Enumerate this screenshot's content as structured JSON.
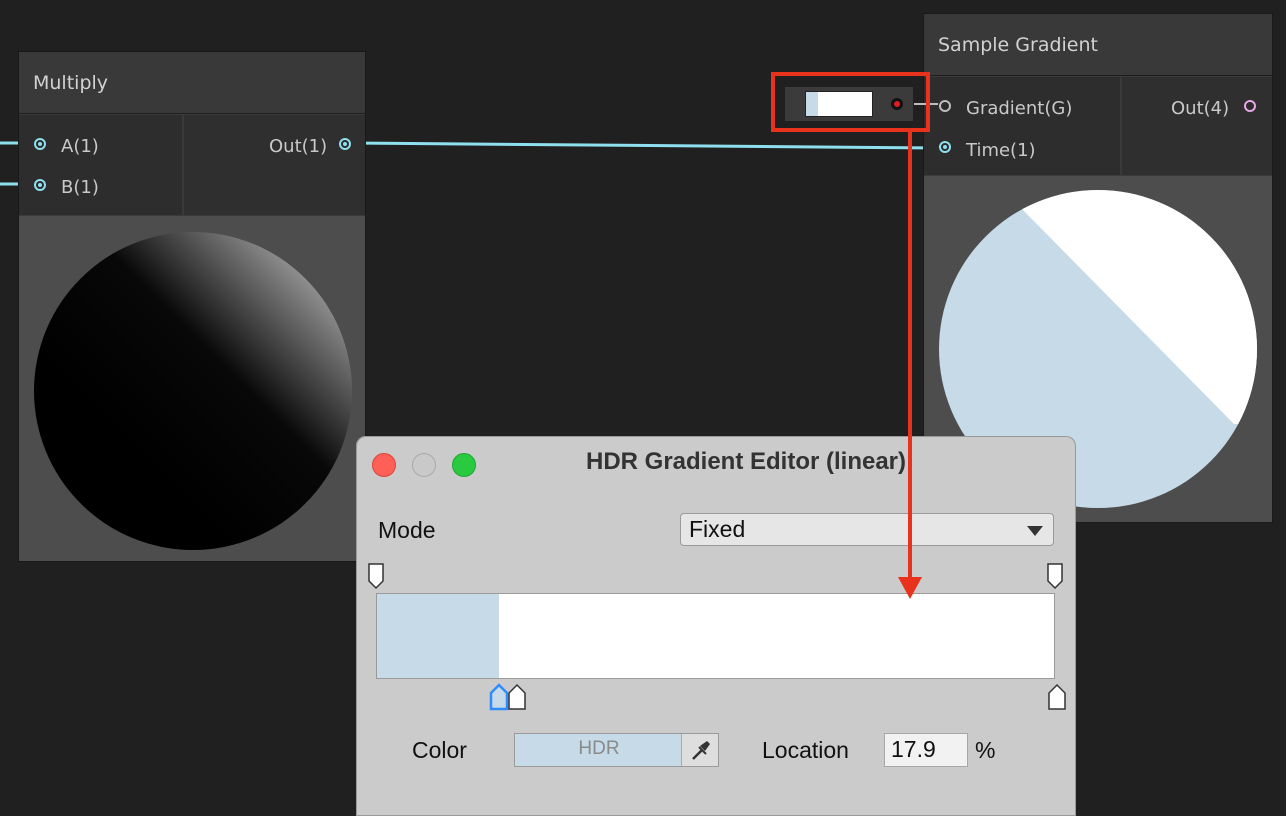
{
  "multiply_node": {
    "title": "Multiply",
    "inputs": [
      {
        "label": "A(1)"
      },
      {
        "label": "B(1)"
      }
    ],
    "outputs": [
      {
        "label": "Out(1)"
      }
    ]
  },
  "sample_gradient_node": {
    "title": "Sample Gradient",
    "inputs": [
      {
        "label": "Gradient(G)"
      },
      {
        "label": "Time(1)"
      }
    ],
    "outputs": [
      {
        "label": "Out(4)"
      }
    ]
  },
  "gradient_field": {
    "icon": "record-dot-icon"
  },
  "highlight": {
    "color": "#e8321c"
  },
  "gradient_editor": {
    "title": "HDR Gradient Editor (linear)",
    "mode_label": "Mode",
    "mode_value": "Fixed",
    "color_label": "Color",
    "color_value": "HDR",
    "location_label": "Location",
    "location_value": "17.9",
    "location_unit": "%",
    "colors": {
      "stop_color": "#c6dae8",
      "end_color": "#ffffff"
    }
  },
  "colors": {
    "connection": "#8fe0ee",
    "background": "#202020",
    "node": "#3a3a3a"
  }
}
